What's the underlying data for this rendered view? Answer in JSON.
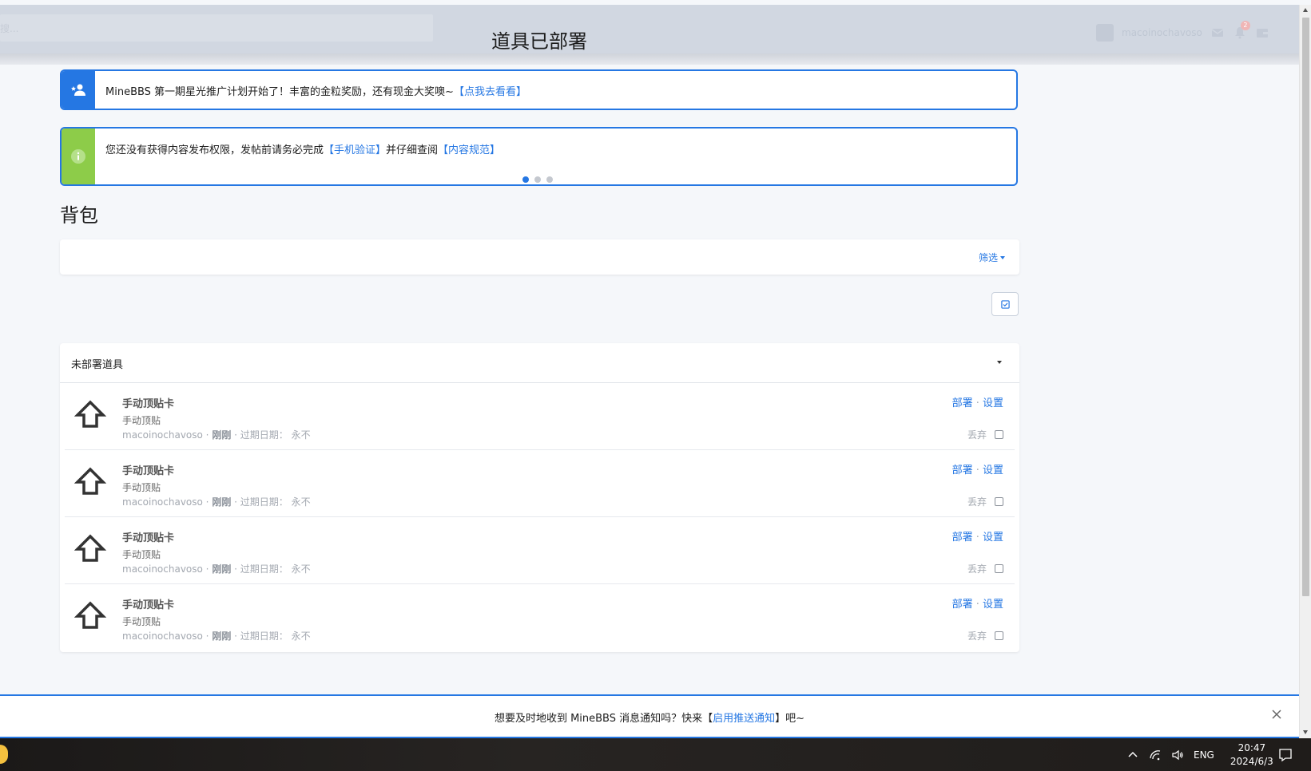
{
  "header": {
    "search_placeholder": "搜...",
    "toast_title": "道具已部署",
    "username": "macoinochavoso",
    "notification_count": "2"
  },
  "notices": [
    {
      "text": "MineBBS 第一期星光推广计划开始了！丰富的金粒奖励，还有现金大奖噢~",
      "link": "【点我去看看】"
    },
    {
      "text_before": "您还没有获得内容发布权限，发帖前请务必完成",
      "link1": "【手机验证】",
      "text_middle": "并仔细查阅",
      "link2": "【内容规范】"
    }
  ],
  "page_title": "背包",
  "filter_label": "筛选",
  "panel": {
    "title": "未部署道具",
    "items": [
      {
        "title": "手动顶贴卡",
        "desc": "手动顶贴",
        "user": "macoinochavoso",
        "time": "刚刚",
        "expire_label": "过期日期：",
        "expire_value": "永不",
        "deploy": "部署",
        "settings": "设置",
        "discard": "丢弃"
      },
      {
        "title": "手动顶贴卡",
        "desc": "手动顶贴",
        "user": "macoinochavoso",
        "time": "刚刚",
        "expire_label": "过期日期：",
        "expire_value": "永不",
        "deploy": "部署",
        "settings": "设置",
        "discard": "丢弃"
      },
      {
        "title": "手动顶贴卡",
        "desc": "手动顶贴",
        "user": "macoinochavoso",
        "time": "刚刚",
        "expire_label": "过期日期：",
        "expire_value": "永不",
        "deploy": "部署",
        "settings": "设置",
        "discard": "丢弃"
      },
      {
        "title": "手动顶贴卡",
        "desc": "手动顶贴",
        "user": "macoinochavoso",
        "time": "刚刚",
        "expire_label": "过期日期：",
        "expire_value": "永不",
        "deploy": "部署",
        "settings": "设置",
        "discard": "丢弃"
      }
    ]
  },
  "push_banner": {
    "text_before": "想要及时地收到 MineBBS 消息通知吗？快来【",
    "link": "启用推送通知",
    "text_after": "】吧~"
  },
  "taskbar": {
    "language": "ENG",
    "time": "20:47",
    "date": "2024/6/3"
  },
  "colors": {
    "accent": "#2577e3",
    "notice_green": "#8dcc49",
    "header_bg": "#d1d7e1"
  }
}
